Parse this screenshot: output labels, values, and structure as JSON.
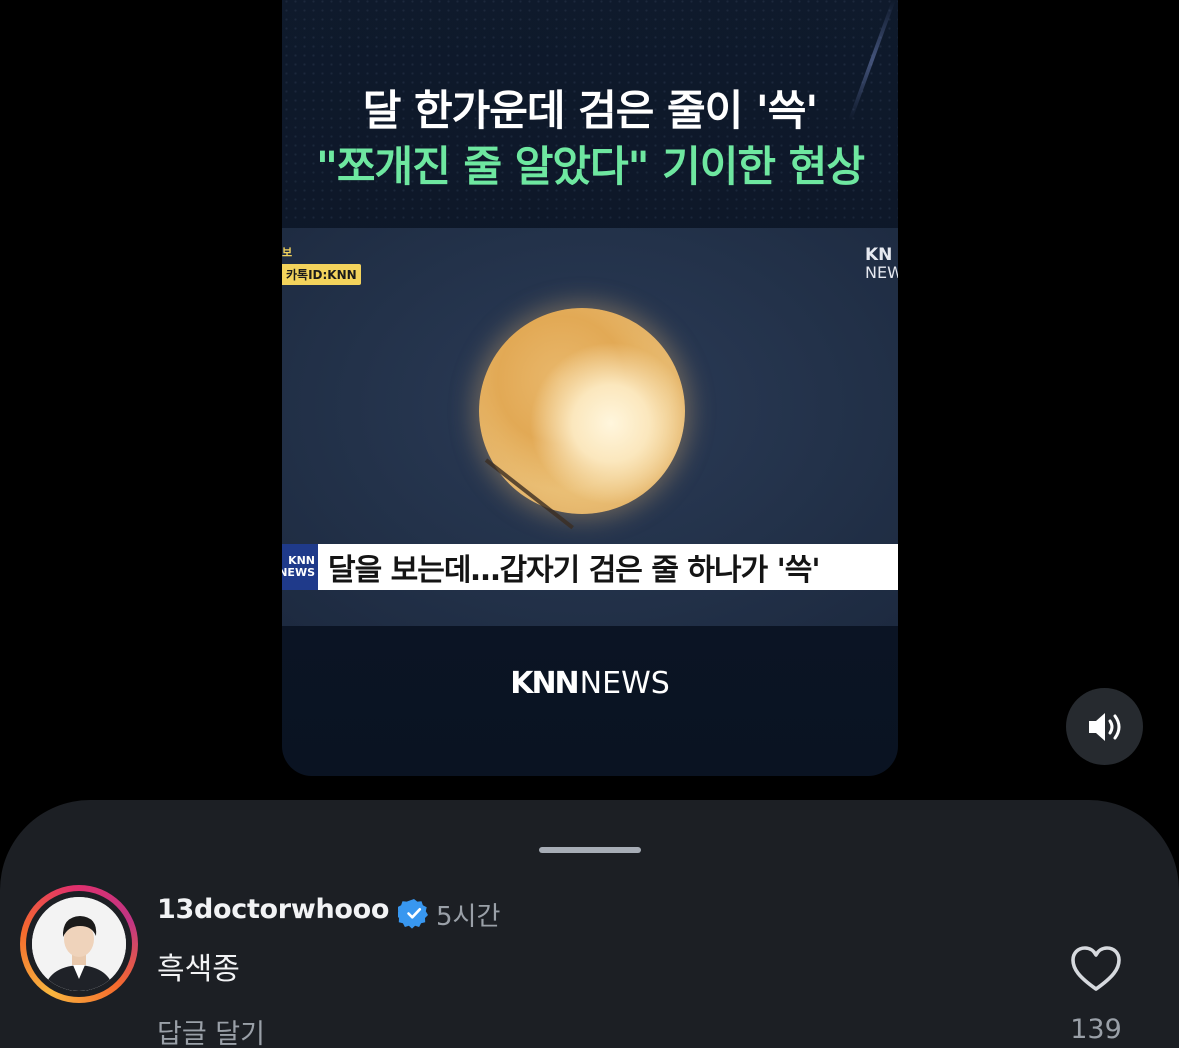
{
  "video": {
    "headline_line1": "달 한가운데 검은 줄이 '쓱'",
    "headline_line2": "\"쪼개진 줄 알았다\" 기이한 현상",
    "corner_tag_top": "보",
    "kakao_tag": "카톡ID:KNN",
    "corner_logo_line1": "KN",
    "corner_logo_line2": "NEW",
    "lower_third_logo_line1": "KNN",
    "lower_third_logo_line2": "NEWS",
    "lower_third_text": "달을 보는데…갑자기 검은 줄 하나가 '쓱'",
    "brand_knn": "KNN",
    "brand_news": "NEWS"
  },
  "controls": {
    "volume_icon": "speaker-volume-icon"
  },
  "comment": {
    "username": "13doctorwhooo",
    "verified_icon": "verified-badge-icon",
    "time": "5시간",
    "text": "흑색종",
    "reply_label": "답글 달기",
    "like_icon": "heart-icon",
    "like_count": "139"
  },
  "colors": {
    "accent_green": "#6ee7a0",
    "verified_blue": "#3897f0",
    "sheet_bg": "#1c1f24"
  }
}
